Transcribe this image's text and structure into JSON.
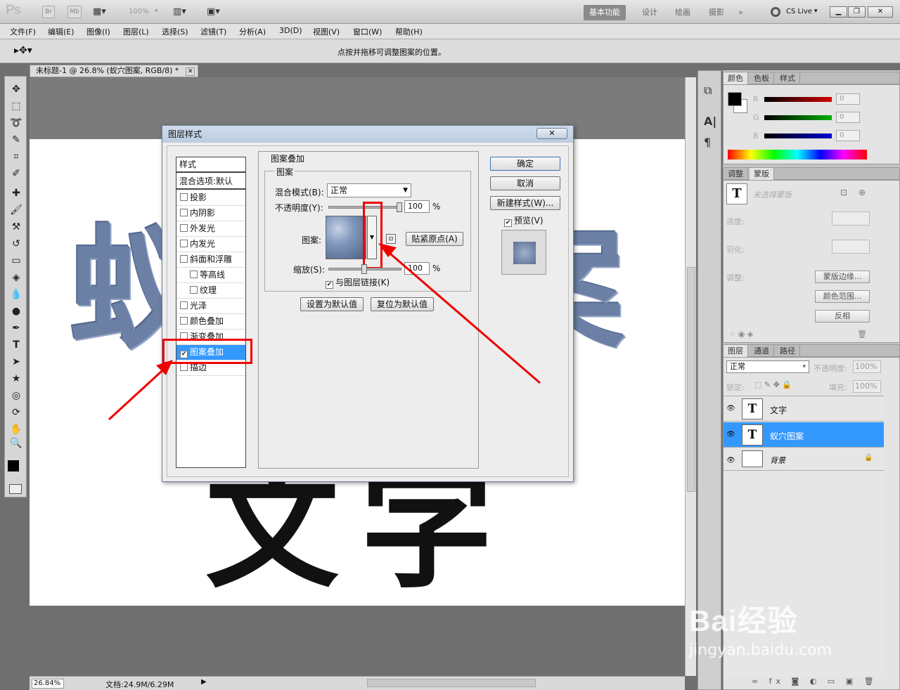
{
  "app": {
    "logo": "Ps",
    "br": "Br",
    "mb": "Mb",
    "zoom": "100%",
    "workspaces": [
      "基本功能",
      "设计",
      "绘画",
      "摄影",
      "»"
    ],
    "cslive": "CS Live"
  },
  "menu": [
    "文件(F)",
    "编辑(E)",
    "图像(I)",
    "图层(L)",
    "选择(S)",
    "滤镜(T)",
    "分析(A)",
    "3D(D)",
    "视图(V)",
    "窗口(W)",
    "帮助(H)"
  ],
  "options": {
    "hint": "点按并拖移可调整图案的位置。"
  },
  "document": {
    "tab_title": "未标题-1 @ 26.8% (蚁穴图案, RGB/8) *",
    "zoom": "26.84%",
    "doc_info": "文档:24.9M/6.29M",
    "canvas_text_top": "蚁穴图案",
    "canvas_text_bottom": "文字"
  },
  "dialog": {
    "title": "图层样式",
    "styles_header": "样式",
    "blend_default": "混合选项:默认",
    "style_items": [
      {
        "label": "投影",
        "checked": false
      },
      {
        "label": "内阴影",
        "checked": false
      },
      {
        "label": "外发光",
        "checked": false
      },
      {
        "label": "内发光",
        "checked": false
      },
      {
        "label": "斜面和浮雕",
        "checked": false
      },
      {
        "label": "等高线",
        "checked": false
      },
      {
        "label": "纹理",
        "checked": false
      },
      {
        "label": "光泽",
        "checked": false
      },
      {
        "label": "颜色叠加",
        "checked": false
      },
      {
        "label": "渐变叠加",
        "checked": false
      },
      {
        "label": "图案叠加",
        "checked": true
      },
      {
        "label": "描边",
        "checked": false
      }
    ],
    "section_title": "图案叠加",
    "group_title": "图案",
    "blend_mode_label": "混合模式(B):",
    "blend_mode_value": "正常",
    "opacity_label": "不透明度(Y):",
    "opacity_value": "100",
    "opacity_unit": "%",
    "pattern_label": "图案:",
    "snap_origin": "贴紧原点(A)",
    "scale_label": "缩放(S):",
    "scale_value": "100",
    "scale_unit": "%",
    "link_label": "与图层链接(K)",
    "link_checked": true,
    "set_default": "设置为默认值",
    "reset_default": "复位为默认值",
    "ok": "确定",
    "cancel": "取消",
    "new_style": "新建样式(W)...",
    "preview": "预览(V)",
    "preview_checked": true
  },
  "color_panel": {
    "tabs": [
      "颜色",
      "色板",
      "样式"
    ],
    "channels": [
      {
        "name": "R",
        "value": "0",
        "color": "#d40000"
      },
      {
        "name": "G",
        "value": "0",
        "color": "#00b000"
      },
      {
        "name": "B",
        "value": "0",
        "color": "#0000d0"
      }
    ]
  },
  "adjust_panel": {
    "tabs": [
      "调整",
      "蒙版"
    ],
    "no_mask": "未选择蒙版",
    "density": "浓度:",
    "feather": "羽化:",
    "refine": "调整:",
    "mask_edge": "蒙版边缘...",
    "color_range": "颜色范围...",
    "invert": "反相"
  },
  "layers_panel": {
    "tabs": [
      "图层",
      "通道",
      "路径"
    ],
    "blend": "正常",
    "opacity_label": "不透明度:",
    "opacity": "100%",
    "lock_label": "锁定:",
    "fill_label": "填充:",
    "fill": "100%",
    "layers": [
      {
        "name": "文字",
        "thumb": "T",
        "selected": false
      },
      {
        "name": "蚁穴图案",
        "thumb": "T",
        "selected": true
      },
      {
        "name": "背景",
        "thumb": "",
        "selected": false
      }
    ]
  },
  "watermark": {
    "brand": "Bai经验",
    "url": "jingyan.baidu.com"
  },
  "colors": {
    "accent": "#3399ff",
    "highlight": "#e00000",
    "pattern": "#6c80a6"
  }
}
